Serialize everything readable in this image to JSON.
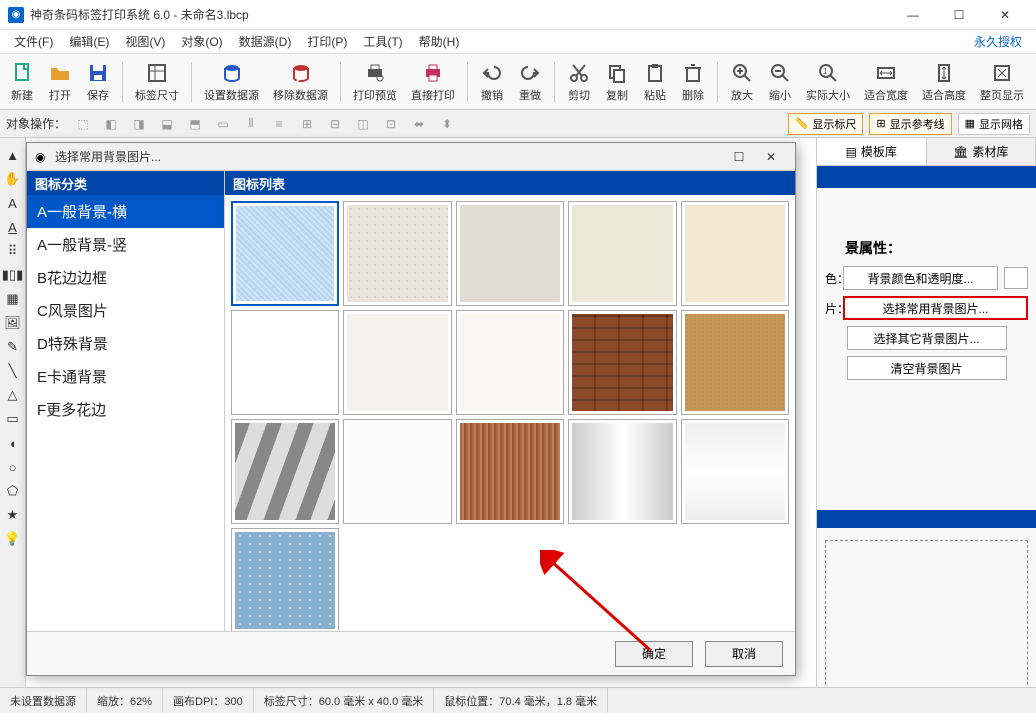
{
  "window": {
    "title": "神奇条码标签打印系统 6.0 - 未命名3.lbcp",
    "license": "永久授权"
  },
  "menus": [
    "文件(F)",
    "编辑(E)",
    "视图(V)",
    "对象(O)",
    "数据源(D)",
    "打印(P)",
    "工具(T)",
    "帮助(H)"
  ],
  "toolbar": [
    {
      "label": "新建",
      "icon": "file-new",
      "color": "#2a8"
    },
    {
      "label": "打开",
      "icon": "folder-open",
      "color": "#e8a030"
    },
    {
      "label": "保存",
      "icon": "save",
      "color": "#2a58c8"
    },
    {
      "sep": true
    },
    {
      "label": "标签尺寸",
      "icon": "resize",
      "color": "#555"
    },
    {
      "sep": true
    },
    {
      "label": "设置数据源",
      "icon": "db-set",
      "color": "#2a58c8"
    },
    {
      "label": "移除数据源",
      "icon": "db-remove",
      "color": "#c03030"
    },
    {
      "sep": true
    },
    {
      "label": "打印预览",
      "icon": "print-preview",
      "color": "#555"
    },
    {
      "label": "直接打印",
      "icon": "print",
      "color": "#c03060"
    },
    {
      "sep": true
    },
    {
      "label": "撤销",
      "icon": "undo",
      "color": "#555"
    },
    {
      "label": "重做",
      "icon": "redo",
      "color": "#555"
    },
    {
      "sep": true
    },
    {
      "label": "剪切",
      "icon": "cut",
      "color": "#555"
    },
    {
      "label": "复制",
      "icon": "copy",
      "color": "#555"
    },
    {
      "label": "粘贴",
      "icon": "paste",
      "color": "#555"
    },
    {
      "label": "删除",
      "icon": "delete",
      "color": "#555"
    },
    {
      "sep": true
    },
    {
      "label": "放大",
      "icon": "zoom-in",
      "color": "#555"
    },
    {
      "label": "缩小",
      "icon": "zoom-out",
      "color": "#555"
    },
    {
      "label": "实际大小",
      "icon": "zoom-actual",
      "color": "#555"
    },
    {
      "label": "适合宽度",
      "icon": "fit-width",
      "color": "#555"
    },
    {
      "label": "适合高度",
      "icon": "fit-height",
      "color": "#555"
    },
    {
      "label": "整页显示",
      "icon": "fit-page",
      "color": "#555"
    }
  ],
  "secondary": {
    "label": "对象操作：",
    "toggles": [
      {
        "label": "显示标尺",
        "icon": "ruler-icon",
        "active": true
      },
      {
        "label": "显示参考线",
        "icon": "guides-icon",
        "active": true
      },
      {
        "label": "显示网格",
        "icon": "grid-icon",
        "active": false
      }
    ]
  },
  "right_panel": {
    "tabs": [
      {
        "label": "模板库",
        "icon": "template-icon",
        "active": true
      },
      {
        "label": "素材库",
        "icon": "assets-icon",
        "active": false
      }
    ],
    "section_title": "景属性：",
    "rows": [
      {
        "label": "色：",
        "button": "背景颜色和透明度...",
        "swatch": true
      },
      {
        "label": "片：",
        "button": "选择常用背景图片...",
        "highlight": true
      }
    ],
    "extra_buttons": [
      "选择其它背景图片...",
      "清空背景图片"
    ]
  },
  "modal": {
    "title": "选择常用背景图片...",
    "cat_header": "图标分类",
    "list_header": "图标列表",
    "categories": [
      "A一般背景-横",
      "A一般背景-竖",
      "B花边边框",
      "C风景图片",
      "D特殊背景",
      "E卡通背景",
      "F更多花边"
    ],
    "selected_cat": 0,
    "selected_thumb": 0,
    "thumbs": [
      "tx1",
      "tx2",
      "tx3",
      "tx4",
      "tx5",
      "tx6",
      "tx7",
      "tx8",
      "tx9",
      "tx10",
      "tx11",
      "tx12",
      "tx13",
      "tx14",
      "tx15",
      "tx16"
    ],
    "ok": "确定",
    "cancel": "取消"
  },
  "statusbar": {
    "datasource": "未设置数据源",
    "zoom": "缩放：62%",
    "dpi": "画布DPI：300",
    "label_size": "标签尺寸：60.0 毫米 x 40.0 毫米",
    "mouse": "鼠标位置：70.4 毫米，1.8 毫米"
  }
}
